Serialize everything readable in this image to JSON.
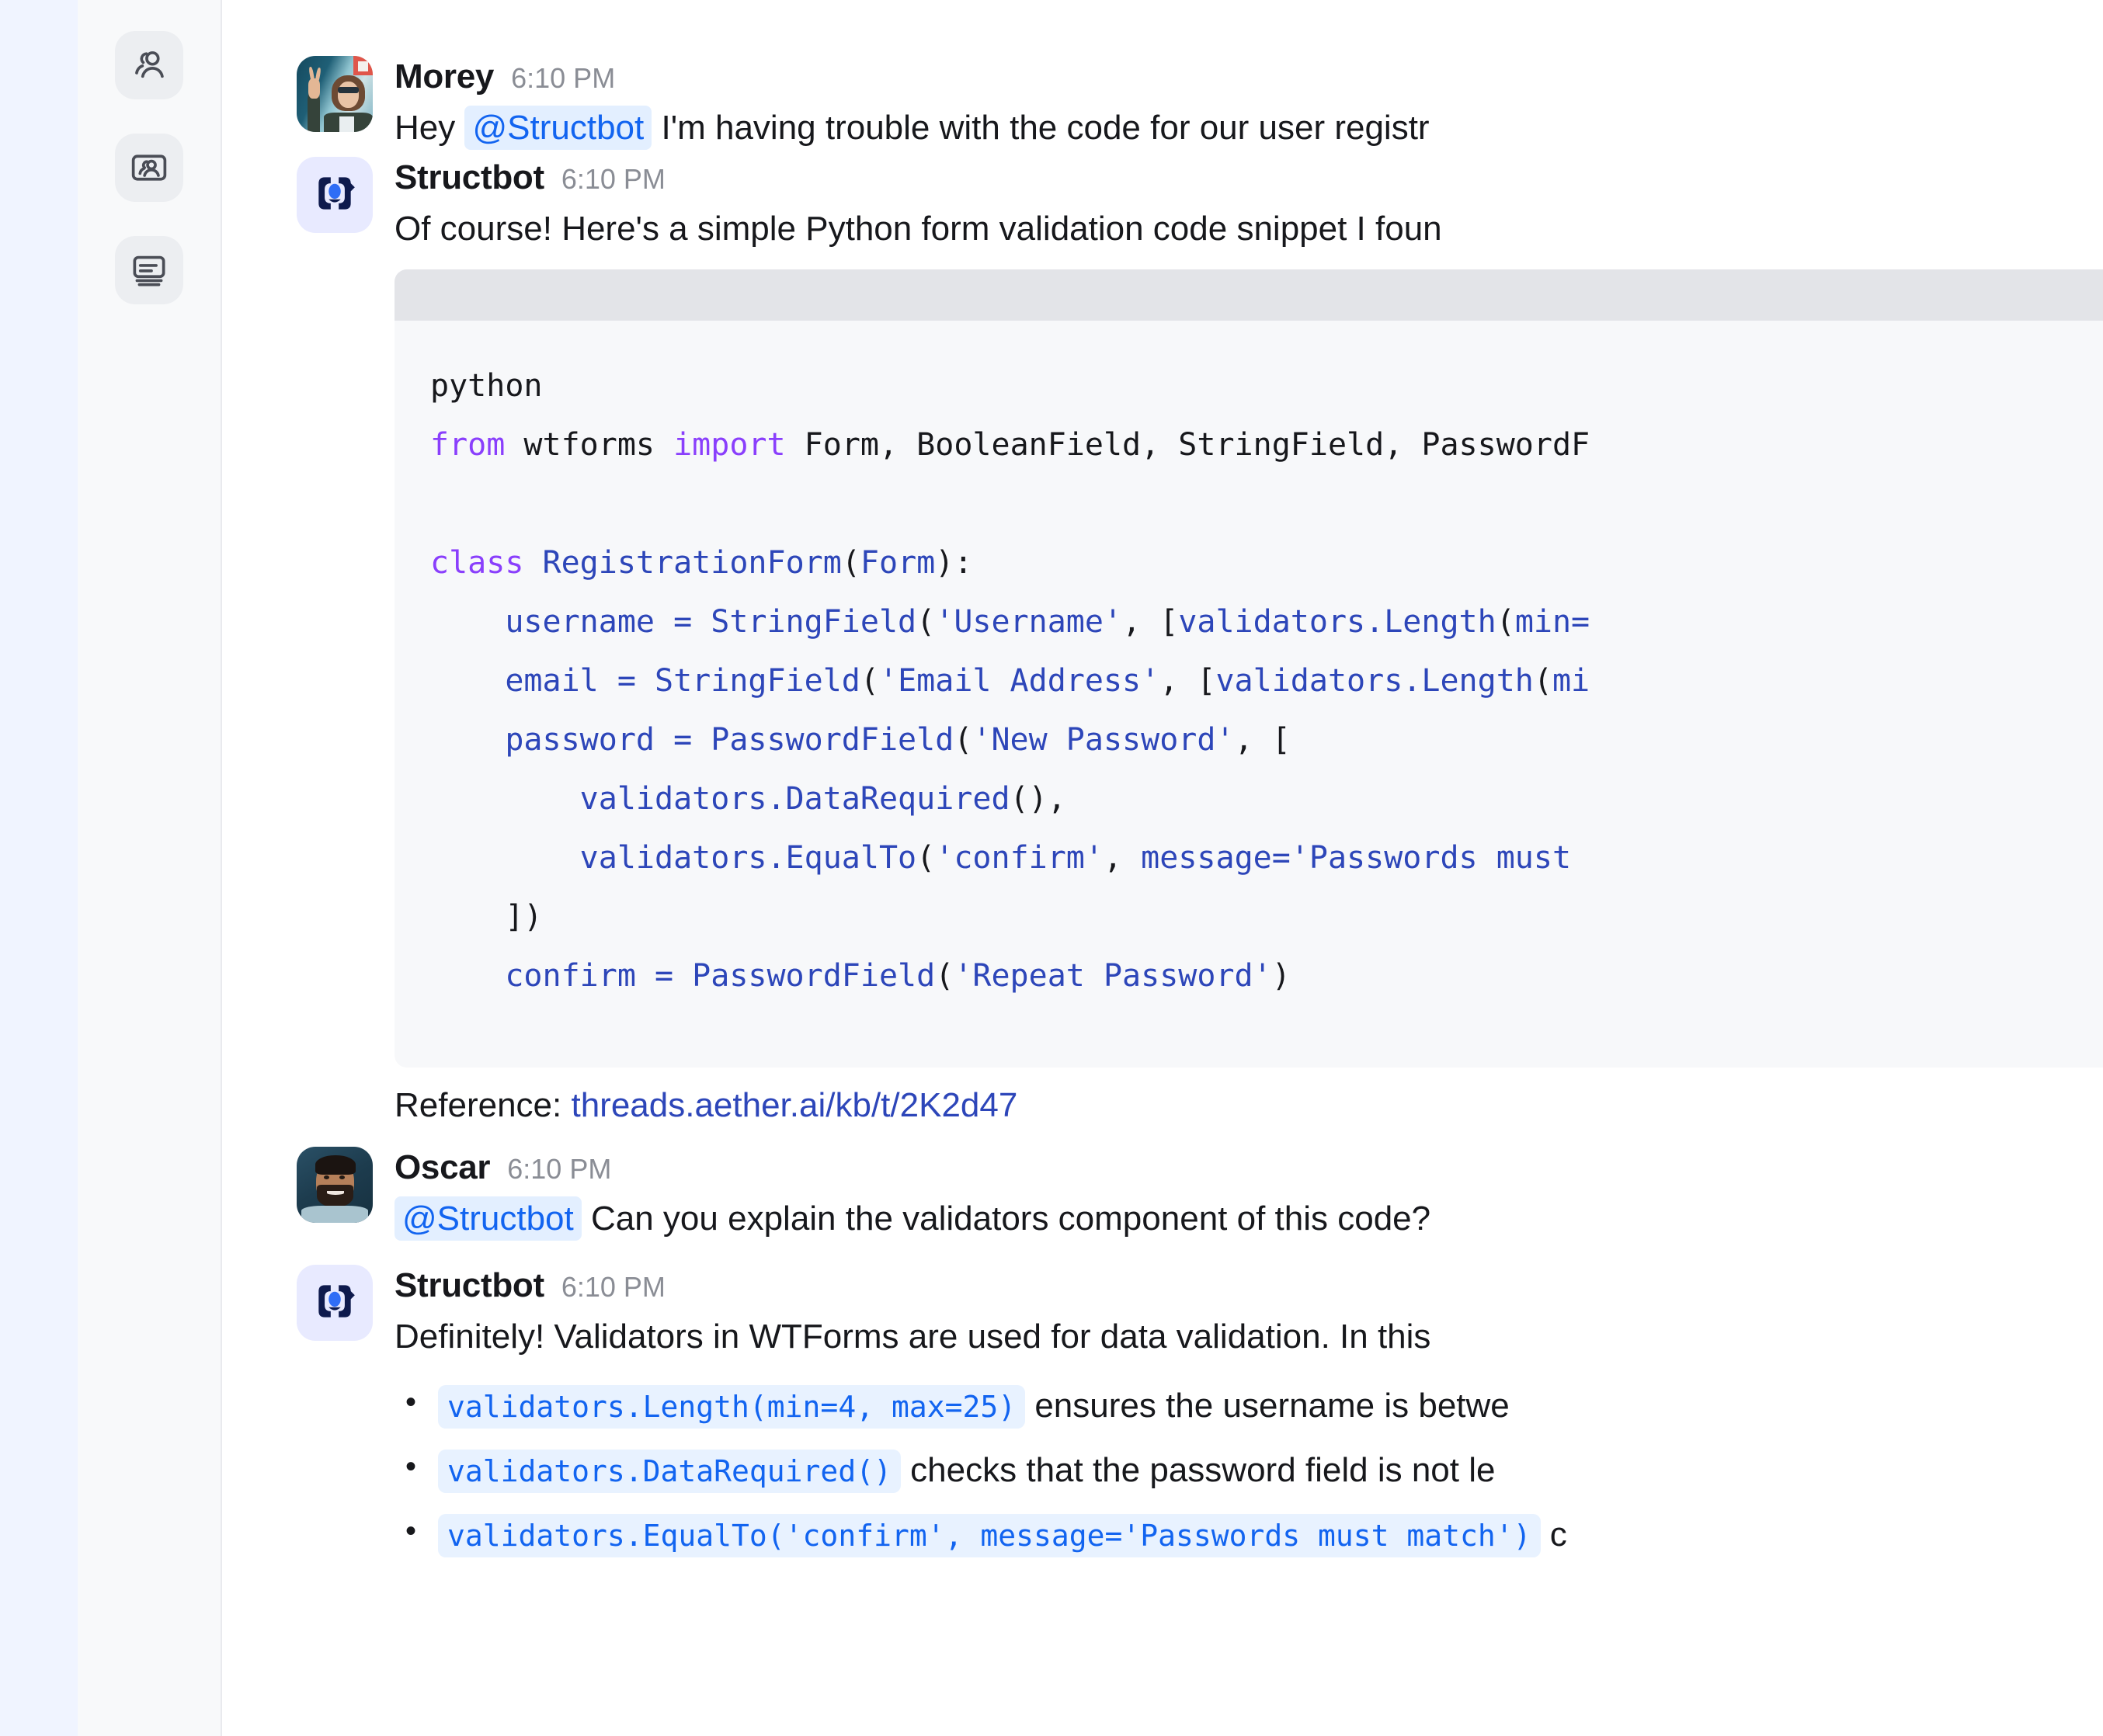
{
  "sidebar": {
    "items": [
      {
        "name": "users-icon",
        "label": "Users"
      },
      {
        "name": "contact-card-icon",
        "label": "Contacts"
      },
      {
        "name": "cards-stack-icon",
        "label": "Cards"
      }
    ]
  },
  "conversation": {
    "messages": [
      {
        "id": "morey-1",
        "author": "Morey",
        "time": "6:10 PM",
        "avatar": "morey-photo",
        "text_before": "Hey ",
        "mention": "@Structbot",
        "text_after": " I'm having trouble with the code for our user registr"
      },
      {
        "id": "structbot-1",
        "author": "Structbot",
        "time": "6:10 PM",
        "avatar": "structbot-logo",
        "text": "Of course! Here's a simple Python form validation code snippet I foun"
      },
      {
        "id": "oscar-1",
        "author": "Oscar",
        "time": "6:10 PM",
        "avatar": "oscar-photo",
        "mention": "@Structbot",
        "text_after": " Can you explain the validators component of this code?"
      },
      {
        "id": "structbot-2",
        "author": "Structbot",
        "time": "6:10 PM",
        "avatar": "structbot-logo",
        "text": "Definitely! Validators in WTForms are used for data validation. In this"
      }
    ]
  },
  "code_block": {
    "language": "python",
    "lines": [
      "from wtforms import Form, BooleanField, StringField, PasswordF",
      "",
      "class RegistrationForm(Form):",
      "    username = StringField('Username', [validators.Length(min=",
      "    email = StringField('Email Address', [validators.Length(mi",
      "    password = PasswordField('New Password', [",
      "        validators.DataRequired(),",
      "        validators.EqualTo('confirm', message='Passwords must ",
      "    ])",
      "    confirm = PasswordField('Repeat Password')"
    ]
  },
  "reference": {
    "label": "Reference:",
    "link_text": "threads.aether.ai/kb/t/2K2d47"
  },
  "bullets": [
    {
      "code": "validators.Length(min=4, max=25)",
      "text": " ensures the username is betwe"
    },
    {
      "code": "validators.DataRequired()",
      "text": " checks that the password field is not le"
    },
    {
      "code": "validators.EqualTo('confirm', message='Passwords must match')",
      "text": " c"
    }
  ],
  "colors": {
    "mention_text": "#1264f0",
    "mention_bg": "#e3efff",
    "link": "#2d46b9",
    "code_keyword": "#8a3ffc",
    "code_default": "#2d46b9",
    "inline_code_bg": "#e8f2ff",
    "sidebar_bg": "#f8f9fa",
    "rail_bg": "#f0f4ff",
    "codeblock_bg": "#f7f8fa",
    "codeblock_header": "#e3e4e8"
  }
}
